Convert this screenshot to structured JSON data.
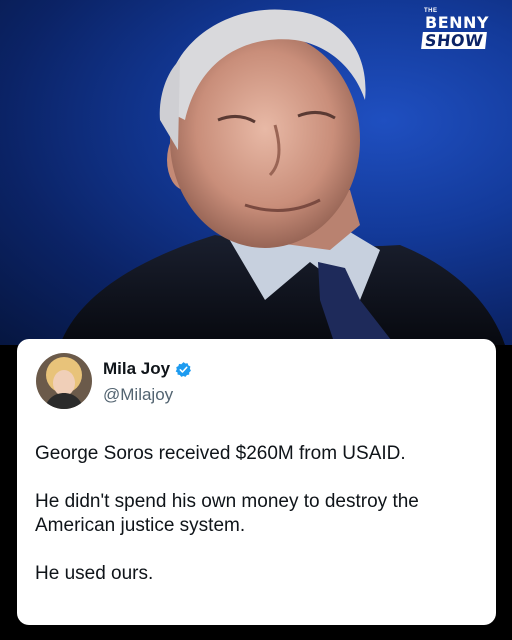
{
  "brand": {
    "small": "THE",
    "line1": "BENNY",
    "line2": "SHOW"
  },
  "post": {
    "author_name": "Mila Joy",
    "author_handle": "@Milajoy",
    "verified": true,
    "paragraphs": [
      "George Soros received $260M from USAID.",
      "He didn't spend his own money to destroy the American justice system.",
      "He used ours."
    ]
  },
  "colors": {
    "background_blue": "#133a9a",
    "verified_badge": "#1d9bf0",
    "text_primary": "#0f1419",
    "text_secondary": "#536471"
  }
}
